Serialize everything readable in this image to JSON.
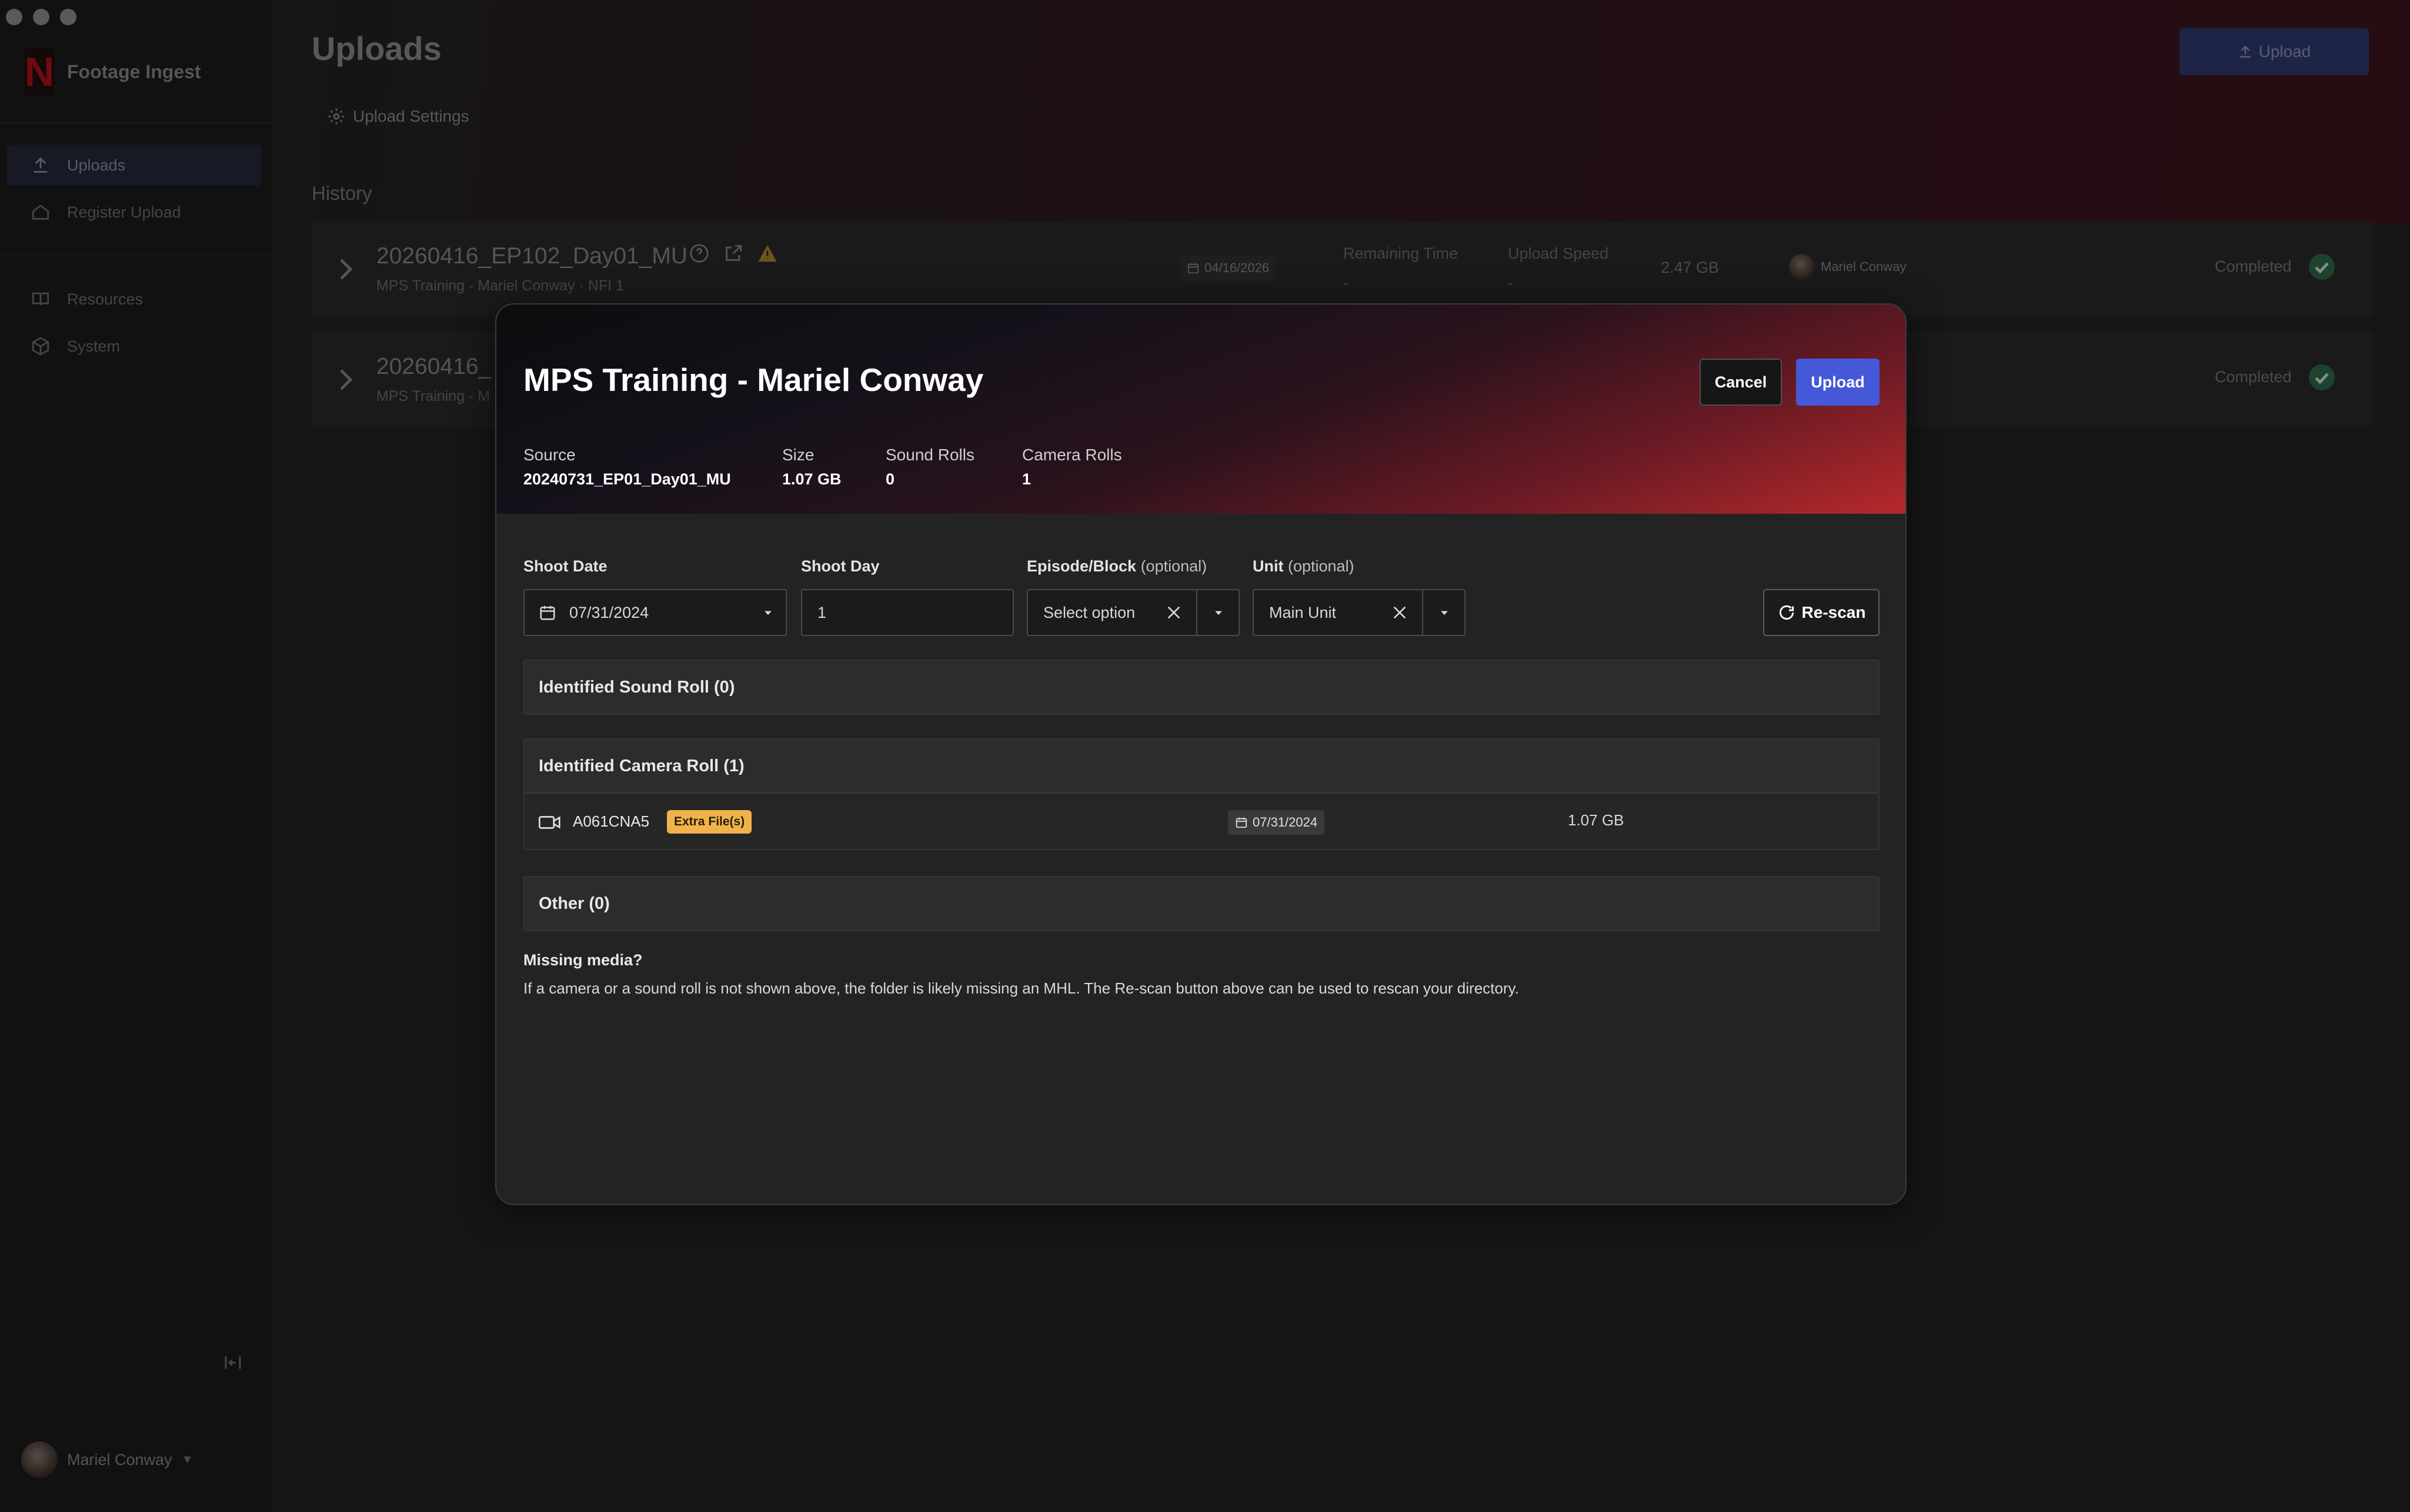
{
  "app": {
    "name": "Footage Ingest"
  },
  "sidebar": {
    "items": [
      {
        "label": "Uploads",
        "active": true
      },
      {
        "label": "Register Upload",
        "active": false
      },
      {
        "label": "Resources",
        "active": false
      },
      {
        "label": "System",
        "active": false
      }
    ],
    "user": {
      "name": "Mariel Conway"
    }
  },
  "header": {
    "title": "Uploads",
    "upload_label": "Upload",
    "settings_label": "Upload Settings"
  },
  "history": {
    "label": "History",
    "rows": [
      {
        "name": "20260416_EP102_Day01_MU",
        "subtitle": "MPS Training - Mariel Conway · NFI 1",
        "date": "04/16/2026",
        "remaining_label": "Remaining Time",
        "remaining_value": "-",
        "speed_label": "Upload Speed",
        "speed_value": "-",
        "size": "2.47 GB",
        "user": "Mariel Conway",
        "status": "Completed"
      },
      {
        "name": "20260416_",
        "subtitle": "MPS Training - M",
        "status": "Completed"
      }
    ]
  },
  "modal": {
    "title": "MPS Training - Mariel Conway",
    "cancel_label": "Cancel",
    "upload_label": "Upload",
    "meta": [
      {
        "label": "Source",
        "value": "20240731_EP01_Day01_MU"
      },
      {
        "label": "Size",
        "value": "1.07 GB"
      },
      {
        "label": "Sound Rolls",
        "value": "0"
      },
      {
        "label": "Camera Rolls",
        "value": "1"
      }
    ],
    "fields": {
      "shoot_date": {
        "label": "Shoot Date",
        "value": "07/31/2024"
      },
      "shoot_day": {
        "label": "Shoot Day",
        "value": "1"
      },
      "episode": {
        "label": "Episode/Block",
        "optional": "(optional)",
        "value": "Select option"
      },
      "unit": {
        "label": "Unit",
        "optional": "(optional)",
        "value": "Main Unit"
      }
    },
    "rescan_label": "Re-scan",
    "sections": {
      "sound": "Identified Sound Roll (0)",
      "camera": "Identified Camera Roll (1)",
      "other": "Other (0)"
    },
    "camera_rolls": [
      {
        "name": "A061CNA5",
        "badge": "Extra File(s)",
        "date": "07/31/2024",
        "size": "1.07 GB"
      }
    ],
    "missing": {
      "title": "Missing media?",
      "text": "If a camera or a sound roll is not shown above, the folder is likely missing an MHL. The Re-scan button above can be used to rescan your directory."
    }
  },
  "colors": {
    "accent": "#4458d8",
    "badge": "#f0b34a",
    "brand": "#b3121a",
    "success": "#2f6b49"
  }
}
